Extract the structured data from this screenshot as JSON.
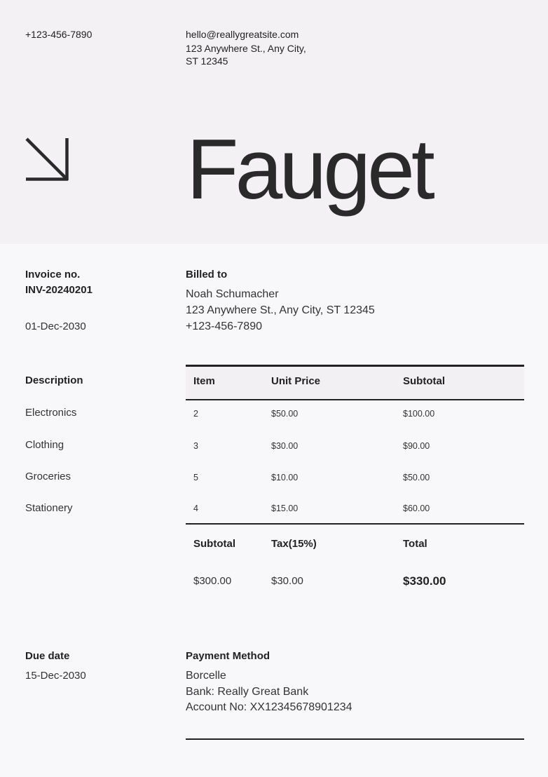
{
  "header": {
    "phone": "+123-456-7890",
    "email": "hello@reallygreatsite.com",
    "address_line1": "123 Anywhere St., Any City,",
    "address_line2": "ST 12345",
    "brand": "Fauget",
    "arrow_icon": "arrow-down-right-icon"
  },
  "invoice": {
    "number_label": "Invoice no.",
    "number": "INV-20240201",
    "date": "01-Dec-2030"
  },
  "billed_to": {
    "label": "Billed to",
    "name": "Noah Schumacher",
    "address": "123 Anywhere St., Any City, ST 12345",
    "phone": "+123-456-7890"
  },
  "items": {
    "description_label": "Description",
    "headers": {
      "item": "Item",
      "unit_price": "Unit Price",
      "subtotal": "Subtotal"
    },
    "rows": [
      {
        "description": "Electronics",
        "qty": "2",
        "unit_price": "$50.00",
        "subtotal": "$100.00"
      },
      {
        "description": "Clothing",
        "qty": "3",
        "unit_price": "$30.00",
        "subtotal": "$90.00"
      },
      {
        "description": "Groceries",
        "qty": "5",
        "unit_price": "$10.00",
        "subtotal": "$50.00"
      },
      {
        "description": "Stationery",
        "qty": "4",
        "unit_price": "$15.00",
        "subtotal": "$60.00"
      }
    ]
  },
  "totals": {
    "subtotal_label": "Subtotal",
    "tax_label": "Tax(15%)",
    "total_label": "Total",
    "subtotal": "$300.00",
    "tax": "$30.00",
    "total": "$330.00"
  },
  "due": {
    "label": "Due date",
    "date": "15-Dec-2030"
  },
  "payment": {
    "label": "Payment Method",
    "name": "Borcelle",
    "bank": "Bank: Really Great Bank",
    "account": "Account No: XX12345678901234"
  }
}
